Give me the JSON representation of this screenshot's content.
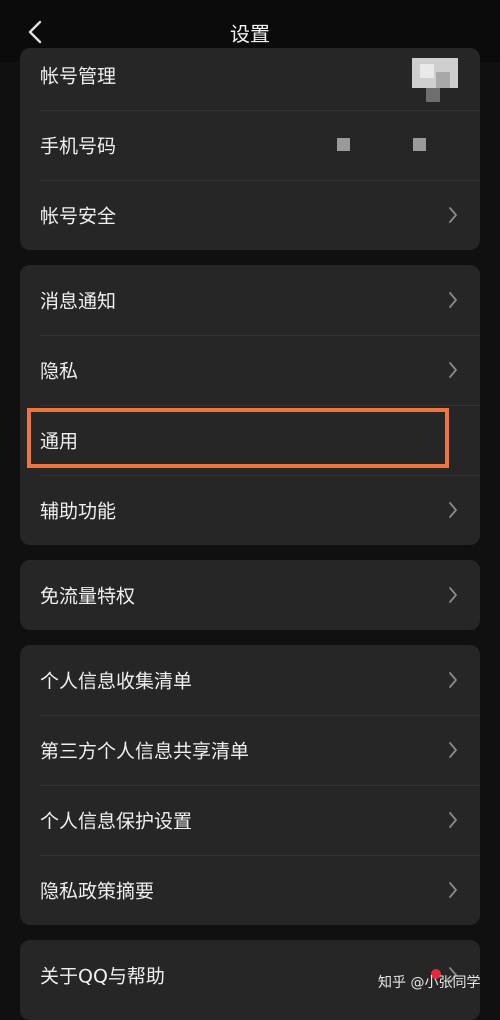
{
  "header": {
    "title": "设置",
    "back_icon": "chevron-left-icon"
  },
  "account_group": {
    "items": [
      {
        "label": "帐号管理"
      },
      {
        "label": "手机号码"
      },
      {
        "label": "帐号安全"
      }
    ]
  },
  "settings_group": {
    "items": [
      {
        "label": "消息通知"
      },
      {
        "label": "隐私"
      },
      {
        "label": "通用"
      },
      {
        "label": "辅助功能"
      }
    ]
  },
  "data_plan_group": {
    "items": [
      {
        "label": "免流量特权"
      }
    ]
  },
  "privacy_group": {
    "items": [
      {
        "label": "个人信息收集清单"
      },
      {
        "label": "第三方个人信息共享清单"
      },
      {
        "label": "个人信息保护设置"
      },
      {
        "label": "隐私政策摘要"
      }
    ]
  },
  "about_group": {
    "items": [
      {
        "label": "关于QQ与帮助"
      }
    ]
  },
  "watermark": "知乎 @小张同学",
  "colors": {
    "background": "#101010",
    "card": "#262626",
    "highlight": "#f0743f",
    "notification_dot": "#e8283a"
  }
}
